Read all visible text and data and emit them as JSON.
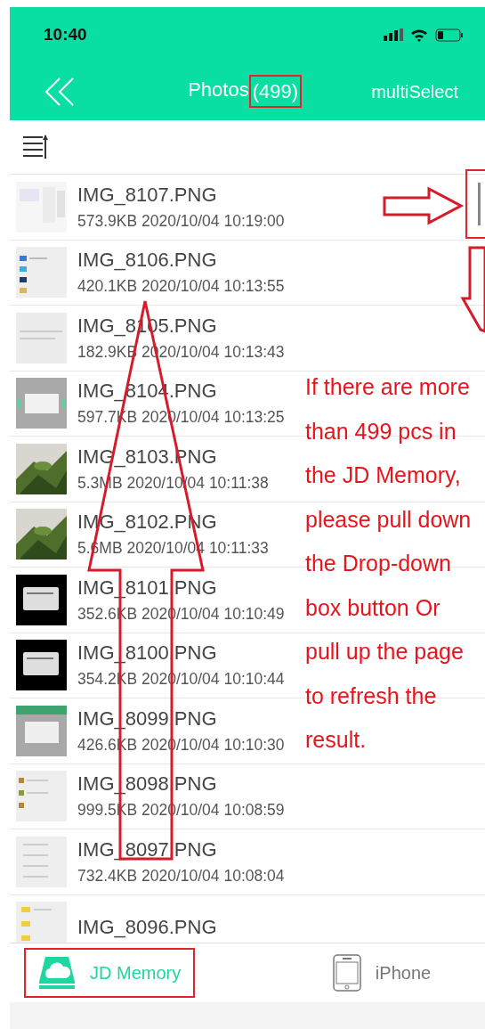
{
  "status_bar": {
    "time": "10:40"
  },
  "nav": {
    "title": "Photos",
    "count": "(499)",
    "count_highlighted": true,
    "action": "multiSelect"
  },
  "files": [
    {
      "name": "IMG_8107.PNG",
      "meta": "573.9KB 2020/10/04 10:19:00"
    },
    {
      "name": "IMG_8106.PNG",
      "meta": "420.1KB 2020/10/04 10:13:55"
    },
    {
      "name": "IMG_8105.PNG",
      "meta": "182.9KB 2020/10/04 10:13:43"
    },
    {
      "name": "IMG_8104.PNG",
      "meta": "597.7KB 2020/10/04 10:13:25"
    },
    {
      "name": "IMG_8103.PNG",
      "meta": "5.3MB 2020/10/04 10:11:38"
    },
    {
      "name": "IMG_8102.PNG",
      "meta": "5.6MB 2020/10/04 10:11:33"
    },
    {
      "name": "IMG_8101.PNG",
      "meta": "352.6KB 2020/10/04 10:10:49"
    },
    {
      "name": "IMG_8100.PNG",
      "meta": "354.2KB 2020/10/04 10:10:44"
    },
    {
      "name": "IMG_8099.PNG",
      "meta": "426.6KB 2020/10/04 10:10:30"
    },
    {
      "name": "IMG_8098.PNG",
      "meta": "999.5KB 2020/10/04 10:08:59"
    },
    {
      "name": "IMG_8097.PNG",
      "meta": "732.4KB 2020/10/04 10:08:04"
    },
    {
      "name": "IMG_8096.PNG"
    }
  ],
  "note_lines": [
    "If there are more",
    "than 499 pcs in",
    "the JD Memory,",
    "please pull down",
    "the Drop-down",
    "box button Or",
    "pull up the page",
    "to refresh the",
    "result."
  ],
  "tabs": [
    {
      "label": "JD Memory",
      "kind": "cloud",
      "selected": true,
      "highlighted": true
    },
    {
      "label": "iPhone",
      "kind": "phone",
      "selected": false,
      "highlighted": false
    }
  ]
}
